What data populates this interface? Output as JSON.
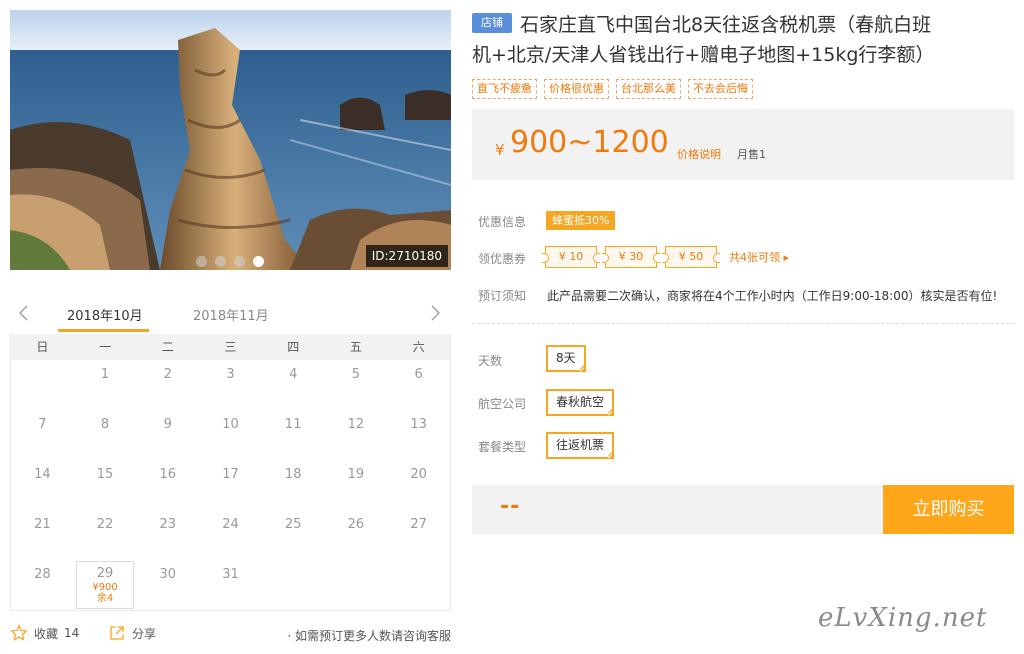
{
  "hero": {
    "id_label": "ID:2710180",
    "slides": 4,
    "active_slide": 4
  },
  "calendar": {
    "months": [
      "2018年10月",
      "2018年11月"
    ],
    "active_month": 0,
    "weekdays": [
      "日",
      "一",
      "二",
      "三",
      "四",
      "五",
      "六"
    ],
    "days": [
      "",
      "1",
      "2",
      "3",
      "4",
      "5",
      "6",
      "7",
      "8",
      "9",
      "10",
      "11",
      "12",
      "13",
      "14",
      "15",
      "16",
      "17",
      "18",
      "19",
      "20",
      "21",
      "22",
      "23",
      "24",
      "25",
      "26",
      "27",
      "28",
      "29",
      "30",
      "31",
      "",
      "",
      ""
    ],
    "available": {
      "day": "29",
      "price": "¥900",
      "remain": "余4"
    }
  },
  "actions": {
    "favorite_label": "收藏",
    "favorite_count": "14",
    "share_label": "分享",
    "consult": "· 如需预订更多人数请咨询客服"
  },
  "product": {
    "shop_badge": "店铺",
    "title_line1": "石家庄直飞中国台北8天往返含税机票（春航白班",
    "title_line2": "机+北京/天津人省钱出行+赠电子地图+15kg行李额）",
    "tags": [
      "直飞不疲惫",
      "价格很优惠",
      "台北那么美",
      "不去会后悔"
    ]
  },
  "price": {
    "currency": "¥",
    "range": "900~1200",
    "explain": "价格说明",
    "monthly_sales": "月售1"
  },
  "offers": {
    "discount_label": "优惠信息",
    "discount_badge": "蜂蜜抵30%",
    "coupon_label": "领优惠券",
    "coupons": [
      "¥ 10",
      "¥ 30",
      "¥ 50"
    ],
    "coupon_total": "共4张可领 ▸",
    "notice_label": "预订须知",
    "notice_text": "此产品需要二次确认，商家将在4个工作小时内（工作日9:00-18:00）核实是否有位!"
  },
  "options": {
    "days_label": "天数",
    "days_value": "8天",
    "airline_label": "航空公司",
    "airline_value": "春秋航空",
    "package_label": "套餐类型",
    "package_value": "往返机票"
  },
  "buy": {
    "price": "--",
    "button": "立即购买"
  },
  "watermark": "eLvXing.net",
  "colors": {
    "accent": "#f5a623",
    "price": "#f07a0d",
    "badge": "#5b8ed9",
    "buy_button": "#ffa51a"
  }
}
